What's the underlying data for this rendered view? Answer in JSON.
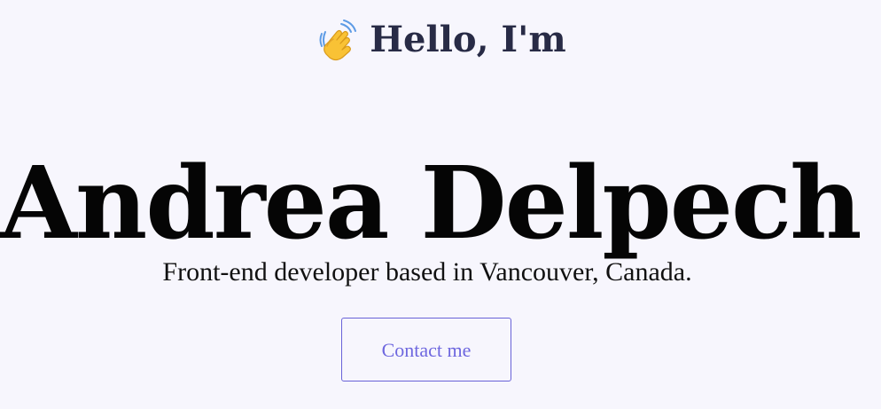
{
  "hero": {
    "wave_icon": "waving-hand-icon",
    "greeting": "Hello, I'm",
    "name": "Andrea Delpech",
    "tagline": "Front-end developer based in Vancouver, Canada.",
    "contact_label": "Contact me"
  },
  "colors": {
    "background": "#f7f6fd",
    "accent": "#6963d8",
    "heading": "#282b46",
    "text": "#111111"
  }
}
